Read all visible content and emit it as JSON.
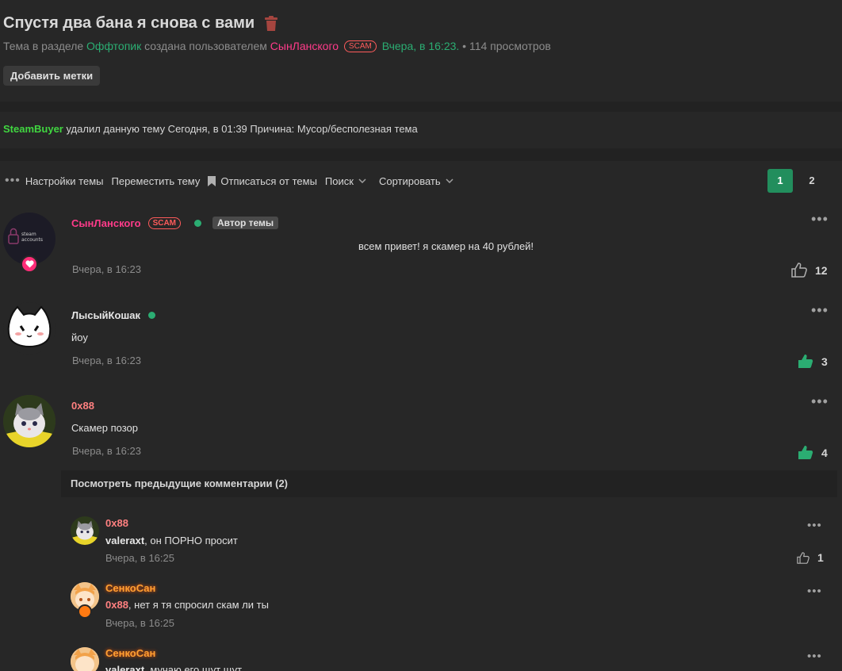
{
  "thread": {
    "title": "Спустя два бана я снова с вами",
    "meta_prefix": "Тема в разделе",
    "section": "Оффтопик",
    "created_by": "создана пользователем",
    "author": "СынЛанского",
    "author_badge": "SCAM",
    "created_time": "Вчера, в 16:23.",
    "views": "• 114 просмотров",
    "add_tags": "Добавить метки"
  },
  "notice": {
    "moderator": "SteamBuyer",
    "text": " удалил данную тему Сегодня, в 01:39 Причина: Мусор/бесполезная тема"
  },
  "toolbar": {
    "settings": "Настройки темы",
    "move": "Переместить тему",
    "unsubscribe": "Отписаться от темы",
    "search": "Поиск",
    "sort": "Сортировать",
    "pages": [
      "1",
      "2"
    ]
  },
  "posts": [
    {
      "user": "СынЛанского",
      "badge": "SCAM",
      "author_label": "Автор темы",
      "text": "всем привет! я скамер на 40 рублей!",
      "time": "Вчера, в 16:23",
      "likes": "12",
      "avatar_text": "steam accounts"
    },
    {
      "user": "ЛысыйКошак",
      "text": "йоу",
      "time": "Вчера, в 16:23",
      "likes": "3"
    },
    {
      "user": "0x88",
      "text": "Скамер позор",
      "time": "Вчера, в 16:23",
      "likes": "4"
    }
  ],
  "prev_comments": "Посмотреть предыдущие комментарии (2)",
  "comments": [
    {
      "user": "0x88",
      "mention": "valeraxt",
      "text": ", он ПОРНО просит",
      "time": "Вчера, в 16:25",
      "likes": "1"
    },
    {
      "user": "СенкоСан",
      "mention": "0x88",
      "text": ", нет я тя спросил скам ли ты",
      "time": "Вчера, в 16:25"
    },
    {
      "user": "СенкоСан",
      "mention": "valeraxt",
      "text": ", мучаю его щут щут"
    }
  ],
  "colors": {
    "accent": "#228e5d",
    "username_pink": "#ff3b8a",
    "moderator": "#40d640",
    "background": "#272727"
  }
}
